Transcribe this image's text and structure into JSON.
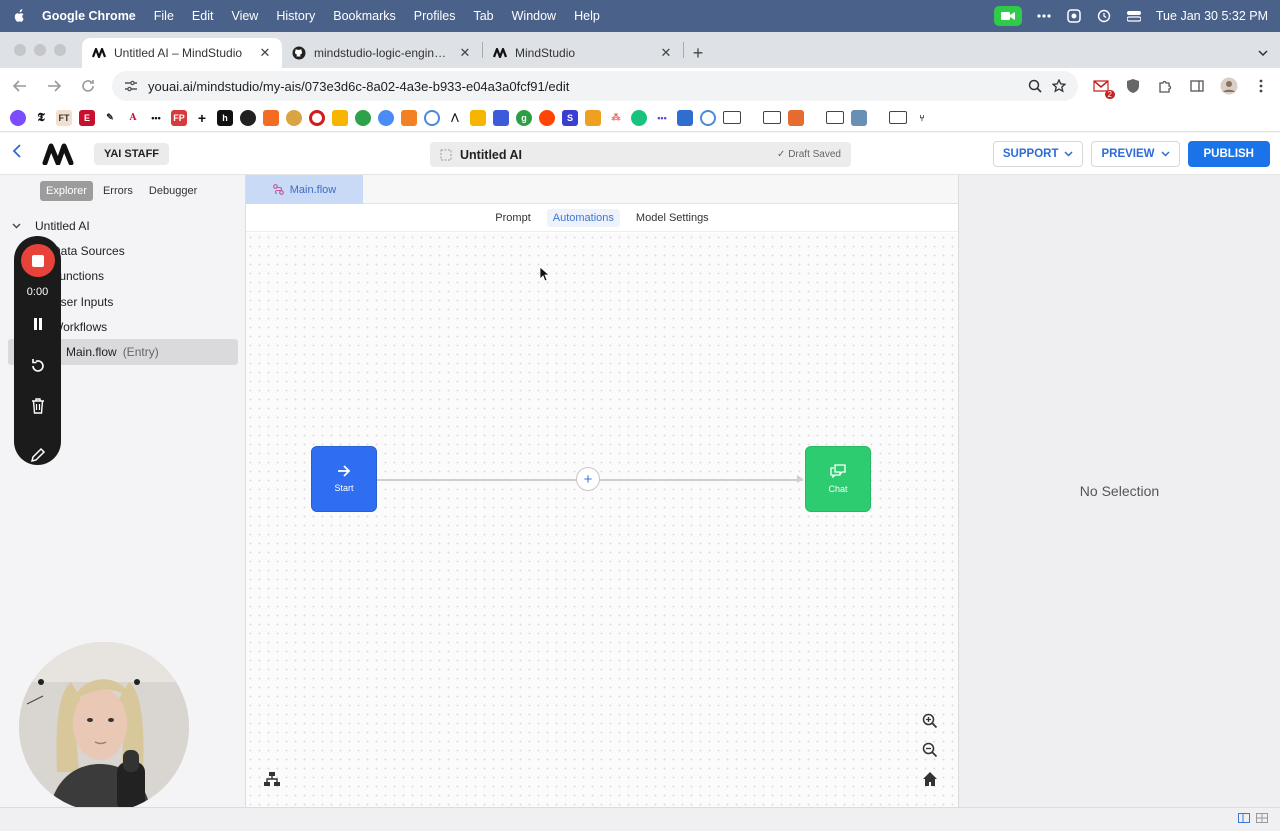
{
  "menubar": {
    "app_name": "Google Chrome",
    "items": [
      "File",
      "Edit",
      "View",
      "History",
      "Bookmarks",
      "Profiles",
      "Tab",
      "Window",
      "Help"
    ],
    "datetime": "Tue Jan 30  5:32 PM"
  },
  "tabs": [
    {
      "title": "Untitled AI – MindStudio",
      "active": true,
      "icon": "mindstudio-icon"
    },
    {
      "title": "mindstudio-logic-engines/en",
      "active": false,
      "icon": "github-icon"
    },
    {
      "title": "MindStudio",
      "active": false,
      "icon": "mindstudio-icon"
    }
  ],
  "address_bar": {
    "url": "youai.ai/mindstudio/my-ais/073e3d6c-8a02-4a3e-b933-e04a3a0fcf91/edit"
  },
  "extension_badge": "2",
  "app_header": {
    "staff_label": "YAI STAFF",
    "ai_title": "Untitled AI",
    "save_status": "Draft Saved",
    "support_label": "SUPPORT",
    "preview_label": "PREVIEW",
    "publish_label": "PUBLISH"
  },
  "sidebar": {
    "tabs": [
      {
        "label": "Explorer",
        "active": true
      },
      {
        "label": "Errors",
        "active": false
      },
      {
        "label": "Debugger",
        "active": false
      }
    ],
    "tree": {
      "root": "Untitled AI",
      "items": [
        "Data Sources",
        "Functions",
        "User Inputs",
        "Workflows"
      ],
      "selected_file": "Main.flow",
      "selected_suffix": "(Entry)"
    }
  },
  "recorder": {
    "time": "0:00"
  },
  "editor": {
    "file_tab": "Main.flow",
    "mode_tabs": [
      {
        "label": "Prompt",
        "active": false
      },
      {
        "label": "Automations",
        "active": true
      },
      {
        "label": "Model Settings",
        "active": false
      }
    ],
    "nodes": {
      "start_label": "Start",
      "chat_label": "Chat"
    }
  },
  "right_panel": {
    "empty_text": "No Selection"
  },
  "colors": {
    "primary": "#1a73e8",
    "start_node": "#2f6ef0",
    "chat_node": "#2ecc71",
    "recorder_stop": "#e8433a",
    "menubar": "#4a6289"
  }
}
